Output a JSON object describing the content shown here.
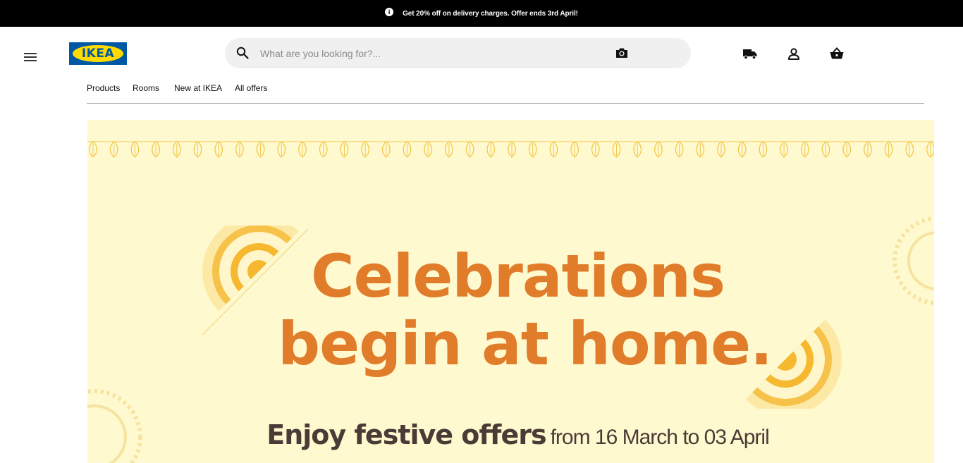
{
  "announcement": {
    "text": "Get 20% off on delivery charges. Offer ends 3rd April!",
    "icon": "info-icon"
  },
  "header": {
    "logo_text": "IKEA",
    "search": {
      "placeholder": "What are you looking for?...",
      "value": ""
    },
    "icons": [
      "menu-icon",
      "search-icon",
      "camera-icon",
      "truck-icon",
      "user-icon",
      "basket-icon"
    ]
  },
  "nav": {
    "items": [
      "Products",
      "Rooms",
      "New at IKEA",
      "All offers"
    ]
  },
  "banner": {
    "headline_line1": "Celebrations",
    "headline_line2": "begin at home.",
    "sub_strong": "Enjoy festive offers",
    "sub_light": "from 16 March to 03 April"
  },
  "colors": {
    "brand_blue": "#0058a3",
    "brand_yellow": "#ffdb00",
    "banner_bg": "#fff9cf",
    "headline": "#e07c2a",
    "subtext": "#4a3b37"
  }
}
